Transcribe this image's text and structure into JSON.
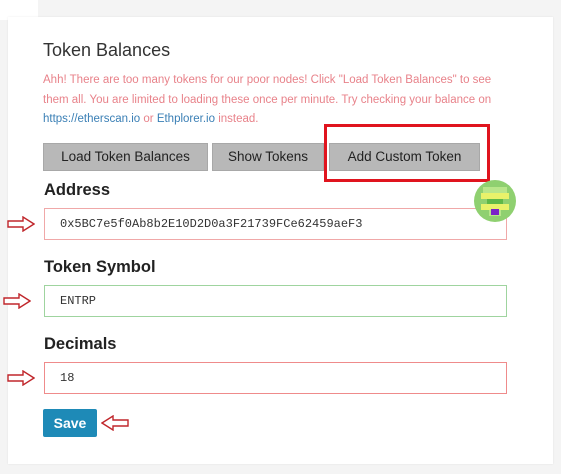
{
  "section": {
    "title": "Token Balances",
    "warning_part1": "Ahh! There are too many tokens for our poor nodes! Click \"Load Token Balances\" to see them all. You are limited to loading these once per minute. Try checking your balance on",
    "link_etherscan": "https://etherscan.io",
    "or_text": "or",
    "link_ethplorer": "Ethplorer.io",
    "warning_part2": "instead."
  },
  "buttons": {
    "load_token_balances": "Load Token Balances",
    "show_tokens": "Show Tokens",
    "add_custom_token": "Add Custom Token",
    "save": "Save"
  },
  "form": {
    "address_label": "Address",
    "address_value": "0x5BC7e5f0Ab8b2E10D2D0a3F21739FCe62459aeF3",
    "symbol_label": "Token Symbol",
    "symbol_value": "ENTRP",
    "decimals_label": "Decimals",
    "decimals_value": "18"
  },
  "colors": {
    "warning_text": "#e8828a",
    "link": "#3a7fb5",
    "highlight_box": "#e0141e",
    "save_button": "#1e8ab7",
    "annotation_arrow": "#c0262b"
  },
  "icons": {
    "identicon": "identicon-avatar",
    "annotation_arrow": "right-arrow-outline-icon"
  }
}
